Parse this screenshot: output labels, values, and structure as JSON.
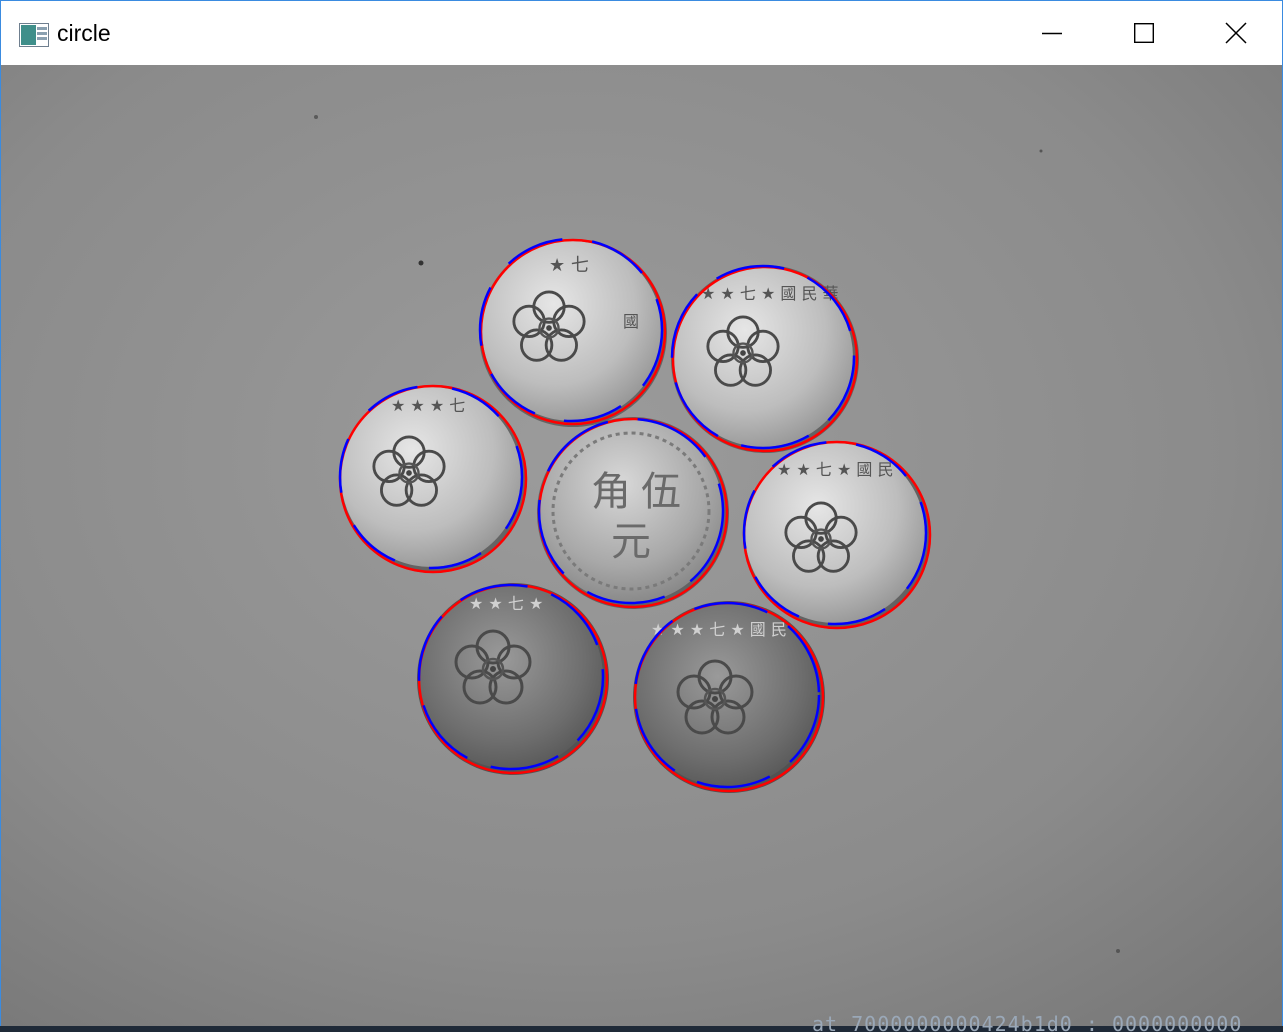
{
  "window": {
    "title": "circle",
    "icon": "opencv-window-icon",
    "controls": [
      {
        "name": "minimize-button",
        "icon": "minimize-icon"
      },
      {
        "name": "maximize-button",
        "icon": "maximize-icon"
      },
      {
        "name": "close-button",
        "icon": "close-icon"
      }
    ]
  },
  "image": {
    "content": "grayscale photo of seven coins with detected circles overlaid",
    "overlay_colors": {
      "detected_a": "#ff0000",
      "detected_b": "#0000ff"
    },
    "coin_glyphs": {
      "center_top": "伍",
      "center_left": "角",
      "center_bottom": "元"
    }
  },
  "background_console": {
    "text": "at 7000000000424b1d0 : 0000000000"
  }
}
